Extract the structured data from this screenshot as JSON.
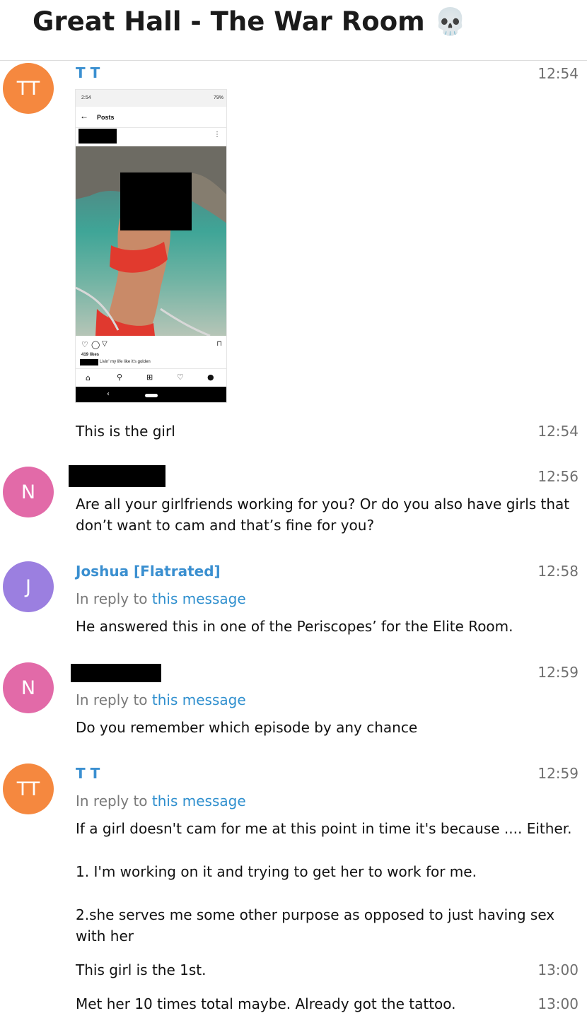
{
  "chat": {
    "title": "Great Hall - The War Room 💀"
  },
  "messages": [
    {
      "avatar_initials": "TT",
      "avatar_color": "#f5883f",
      "sender": "T T",
      "time": "12:54",
      "image": {
        "status_time": "2:54",
        "status_battery": "79%",
        "appbar_title": "Posts",
        "likes": "419 likes",
        "caption": "Livin' my life like it's golden"
      }
    },
    {
      "text": "This is the girl",
      "time": "12:54"
    },
    {
      "avatar_initials": "N",
      "avatar_color": "#e26aa8",
      "time": "12:56",
      "text": "Are all your girlfriends working for you? Or do you also have girls that don’t want to cam and that’s fine for you?"
    },
    {
      "avatar_initials": "J",
      "avatar_color": "#9b7fe0",
      "sender": "Joshua [Flatrated]",
      "time": "12:58",
      "reply_prefix": "In reply to",
      "reply_link": "this message",
      "text": "He answered this in one of the Periscopes’ for the Elite Room."
    },
    {
      "avatar_initials": "N",
      "avatar_color": "#e26aa8",
      "time": "12:59",
      "reply_prefix": "In reply to",
      "reply_link": "this message",
      "text": "Do you remember which episode by any chance"
    },
    {
      "avatar_initials": "TT",
      "avatar_color": "#f5883f",
      "sender": "T T",
      "time": "12:59",
      "reply_prefix": "In reply to",
      "reply_link": "this message",
      "text_1": "If a girl doesn't cam for me at this point in time it's because .... Either.",
      "text_2": "1. I'm working on it and trying to get her to work for me.",
      "text_3": "2.she serves me some other purpose as opposed to just having sex with her"
    },
    {
      "text": "This girl is the 1st.",
      "time": "13:00"
    },
    {
      "text": "Met her 10 times total maybe. Already got the tattoo.",
      "time": "13:00"
    }
  ],
  "colors": {
    "link": "#2f8fce",
    "sender": "#3a8fd0",
    "time": "#6f6f6f"
  },
  "icons": [
    "skull-emoji",
    "back-arrow-icon",
    "heart-icon",
    "comment-icon",
    "share-icon",
    "bookmark-icon",
    "home-icon",
    "search-icon",
    "add-icon",
    "activity-icon",
    "profile-icon"
  ]
}
